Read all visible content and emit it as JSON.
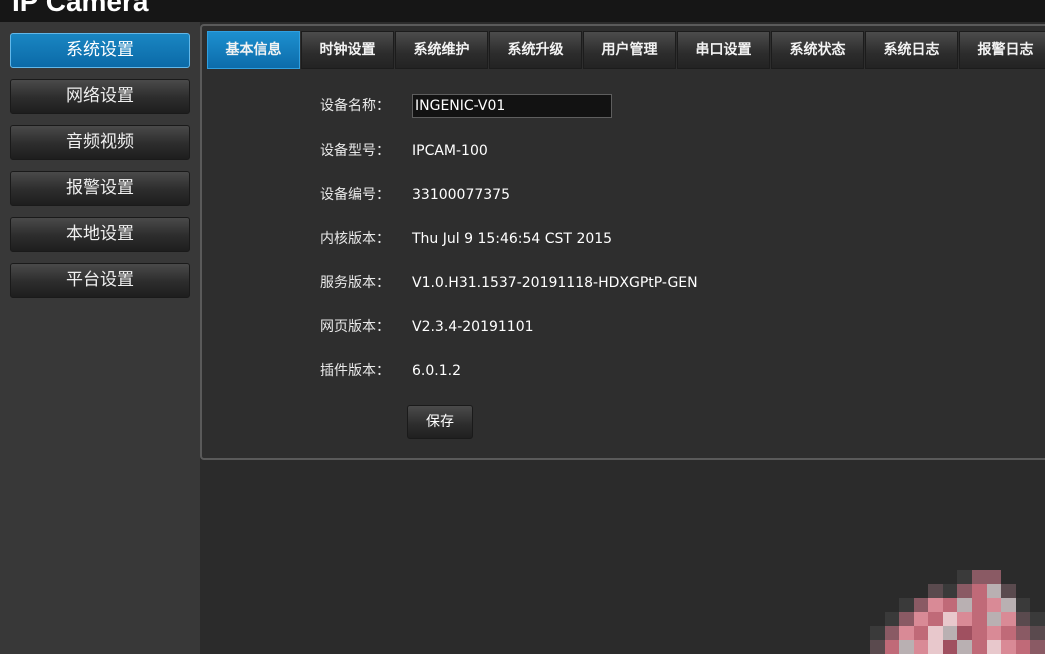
{
  "app": {
    "title": "IP Camera"
  },
  "sidebar": {
    "items": [
      {
        "label": "系统设置",
        "active": true
      },
      {
        "label": "网络设置",
        "active": false
      },
      {
        "label": "音频视频",
        "active": false
      },
      {
        "label": "报警设置",
        "active": false
      },
      {
        "label": "本地设置",
        "active": false
      },
      {
        "label": "平台设置",
        "active": false
      }
    ]
  },
  "tabs": [
    {
      "label": "基本信息",
      "active": true
    },
    {
      "label": "时钟设置",
      "active": false
    },
    {
      "label": "系统维护",
      "active": false
    },
    {
      "label": "系统升级",
      "active": false
    },
    {
      "label": "用户管理",
      "active": false
    },
    {
      "label": "串口设置",
      "active": false
    },
    {
      "label": "系统状态",
      "active": false
    },
    {
      "label": "系统日志",
      "active": false
    },
    {
      "label": "报警日志",
      "active": false
    }
  ],
  "form": {
    "device_name": {
      "label": "设备名称：",
      "value": "INGENIC-V01"
    },
    "device_model": {
      "label": "设备型号：",
      "value": "IPCAM-100"
    },
    "device_serial": {
      "label": "设备编号：",
      "value": "33100077375"
    },
    "kernel_version": {
      "label": "内核版本：",
      "value": "Thu Jul 9 15:46:54 CST 2015"
    },
    "service_version": {
      "label": "服务版本：",
      "value": "V1.0.H31.1537-20191118-HDXGPtP-GEN"
    },
    "web_version": {
      "label": "网页版本：",
      "value": "V2.3.4-20191101"
    },
    "plugin_version": {
      "label": "插件版本：",
      "value": "6.0.1.2"
    }
  },
  "buttons": {
    "save": "保存"
  },
  "colors": {
    "accent_blue": "#0e72b3",
    "background": "#2b2b2b",
    "sidebar": "#383838"
  }
}
